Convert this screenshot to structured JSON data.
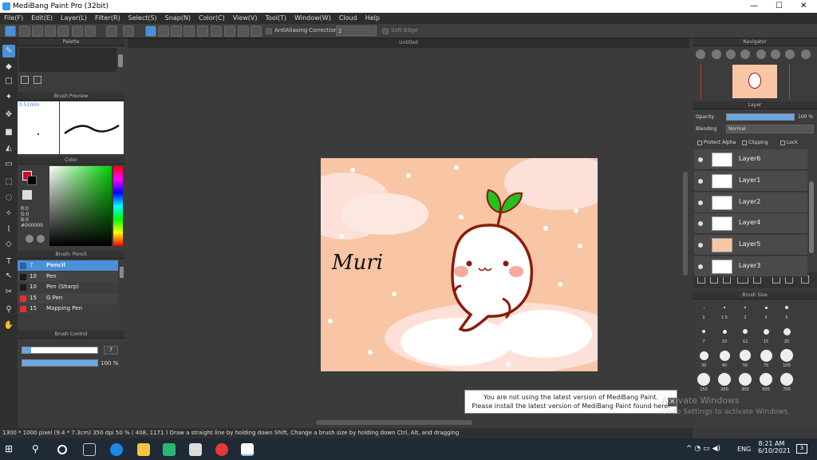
{
  "window": {
    "title": "MediBang Paint Pro (32bit)",
    "minimize": "—",
    "maximize": "☐",
    "close": "✕"
  },
  "menu": [
    "File(F)",
    "Edit(E)",
    "Layer(L)",
    "Filter(R)",
    "Select(S)",
    "Snap(N)",
    "Color(C)",
    "View(V)",
    "Tool(T)",
    "Window(W)",
    "Cloud",
    "Help"
  ],
  "toolbar": {
    "antialiasing": "AntiAliasing",
    "correction_label": "Correction",
    "correction_value": "2",
    "soft_edge": "Soft Edge"
  },
  "panels": {
    "palette": "Palette",
    "brush_preview": {
      "title": "Brush Preview",
      "size": "0.51mm"
    },
    "color": {
      "title": "Color",
      "r": "R:0",
      "g": "G:0",
      "b": "B:0",
      "hex": "#000000",
      "primary": "#c8102e",
      "secondary": "#000000"
    },
    "brush": {
      "title": "Brush: Pencil",
      "items": [
        {
          "size": "7",
          "name": "Pencil",
          "color": "#2b5fa8",
          "selected": true
        },
        {
          "size": "10",
          "name": "Pen",
          "color": "#1a1a1a"
        },
        {
          "size": "10",
          "name": "Pen (Sharp)",
          "color": "#1a1a1a"
        },
        {
          "size": "15",
          "name": "G Pen",
          "color": "#d33"
        },
        {
          "size": "15",
          "name": "Mapping Pen",
          "color": "#d33"
        }
      ]
    },
    "brush_control": {
      "title": "Brush Control",
      "size": "7",
      "opacity": "100 %"
    },
    "navigator": "Navigator",
    "layer": {
      "title": "Layer",
      "opacity_label": "Opacity",
      "opacity_value": "100 %",
      "blending_label": "Blending",
      "blending_value": "Normal",
      "protect_alpha": "Protect Alpha",
      "clipping": "Clipping",
      "lock": "Lock",
      "layers": [
        "Layer6",
        "Layer1",
        "Layer2",
        "Layer4",
        "Layer5",
        "Layer3"
      ]
    },
    "brush_size": {
      "title": "Brush Size",
      "labels": [
        "1",
        "1.5",
        "2",
        "3",
        "5",
        "7",
        "10",
        "12",
        "15",
        "20",
        "30",
        "40",
        "50",
        "70",
        "100",
        "150",
        "200",
        "300",
        "500",
        "700"
      ]
    }
  },
  "canvas": {
    "tab": "Untitled",
    "signature": "Muri"
  },
  "notice": {
    "line1": "You are not using the latest version of MediBang Paint.",
    "line2": "Please install the latest version of MediBang Paint found here.",
    "close": "✕"
  },
  "watermark": {
    "line1": "Activate Windows",
    "line2": "Go to Settings to activate Windows."
  },
  "status": "1300 * 1000 pixel   (9.4 * 7.3cm)   350 dpi   50 %   ( 408, 1171 )   Draw a straight line by holding down Shift, Change a brush size by holding down Ctrl, Alt, and dragging",
  "taskbar": {
    "lang": "ENG",
    "time": "8:21 AM",
    "date": "6/10/2021",
    "notif": "3"
  }
}
